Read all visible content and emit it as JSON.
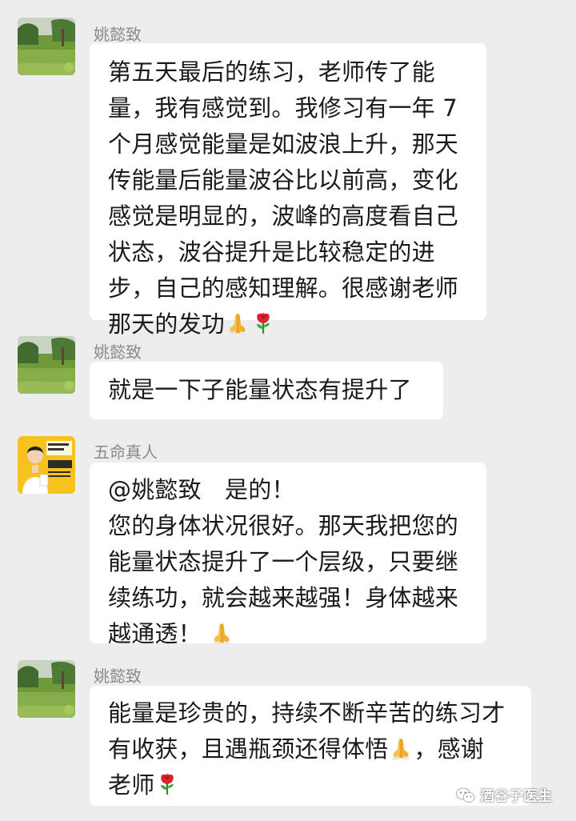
{
  "colors": {
    "background": "#ededed",
    "bubble": "#ffffff",
    "sender_name": "#8a8a8a",
    "message_text": "#1a1a1a"
  },
  "messages": [
    {
      "sender": "姚懿致",
      "avatar": "landscape-photo",
      "lines": [
        "第五天最后的练习，老师传了能",
        "量，我有感觉到。我修习有一年 7",
        "个月感觉能量是如波浪上升，那天",
        "传能量后能量波谷比以前高，变化",
        "感觉是明显的，波峰的高度看自己",
        "状态，波谷提升是比较稳定的进",
        "步，自己的感知理解。很感谢老师",
        "那天的发功"
      ]
    },
    {
      "sender": "姚懿致",
      "avatar": "landscape-photo",
      "lines": [
        "就是一下子能量状态有提升了"
      ]
    },
    {
      "sender": "五命真人",
      "avatar": "doctor-yellow-poster",
      "lines": [
        "@姚懿致　是的！",
        "您的身体状况很好。那天我把您的",
        "能量状态提升了一个层级，只要继",
        "续练功，就会越来越强！身体越来",
        "越通透！ "
      ]
    },
    {
      "sender": "姚懿致",
      "avatar": "landscape-photo",
      "lines": [
        "能量是珍贵的，持续不断辛苦的练习才",
        "有收获，且遇瓶颈还得体悟",
        "，感谢",
        "老师"
      ]
    }
  ],
  "watermark": {
    "text": "酒谷子医生",
    "icon": "wechat-official-account-icon"
  }
}
